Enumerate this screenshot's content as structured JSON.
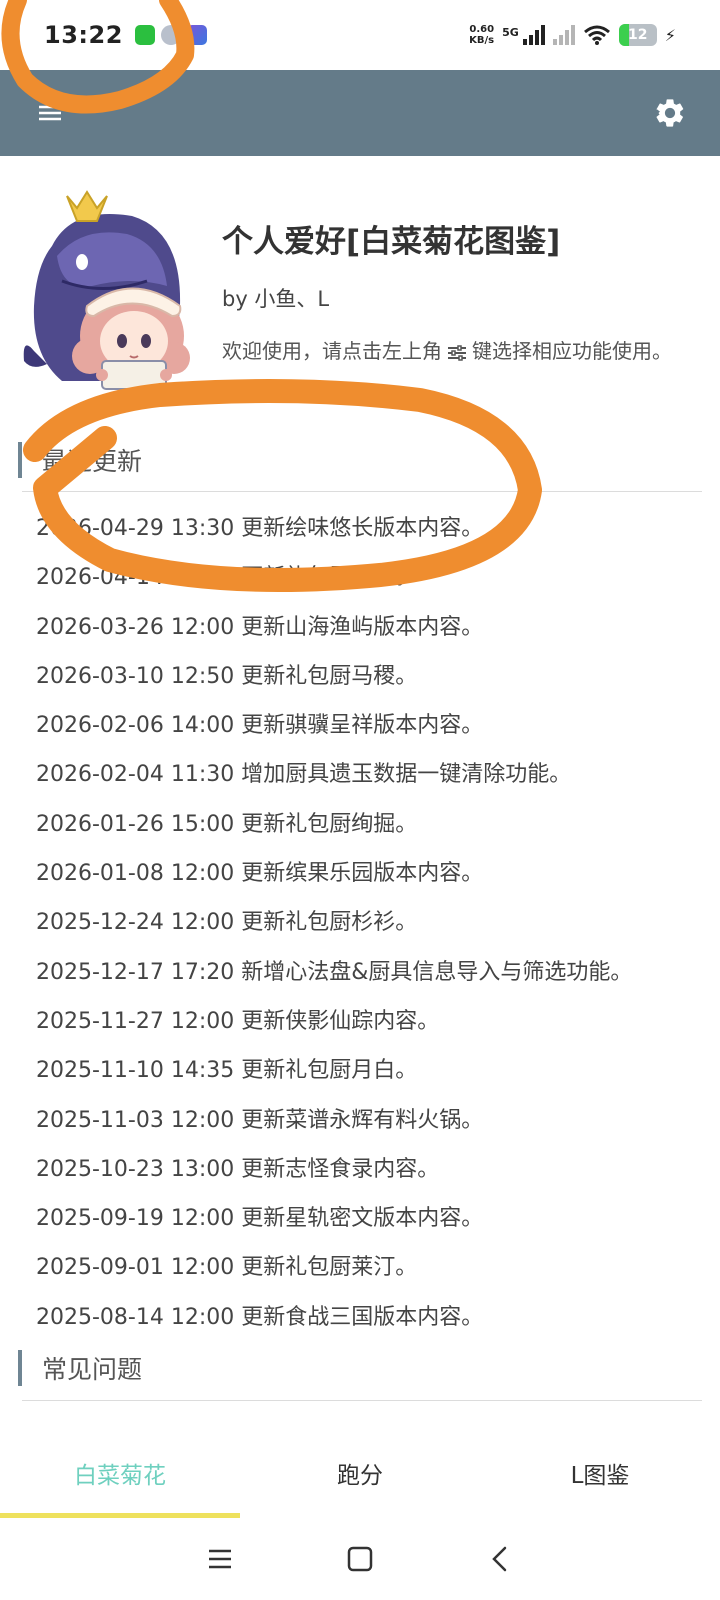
{
  "status_bar": {
    "time": "13:22",
    "net_speed_value": "0.60",
    "net_speed_unit": "KB/s",
    "network_type": "5G",
    "battery_level": "12",
    "icons": [
      "charging-app-icon",
      "sync-app-icon",
      "game-app-icon",
      "signal-icon",
      "signal-off-icon",
      "wifi-icon",
      "battery-icon",
      "charging-bolt-icon"
    ]
  },
  "app_bar": {
    "menu_icon": "menu-icon",
    "settings_icon": "gear-icon",
    "background": "#647b89"
  },
  "header": {
    "title": "个人爱好[白菜菊花图鉴]",
    "author": "by 小鱼、L",
    "desc_before": "欢迎使用，请点击左上角",
    "desc_after": "键选择相应功能使用。"
  },
  "recent_updates": {
    "title": "最近更新",
    "items": [
      "2026-04-29 13:30 更新绘味悠长版本内容。",
      "2026-04-14 10:30 更新礼包厨法彩。",
      "2026-03-26 12:00 更新山海渔屿版本内容。",
      "2026-03-10 12:50 更新礼包厨马稷。",
      "2026-02-06 14:00 更新骐骥呈祥版本内容。",
      "2026-02-04 11:30 增加厨具遗玉数据一键清除功能。",
      "2026-01-26 15:00 更新礼包厨绚掘。",
      "2026-01-08 12:00 更新缤果乐园版本内容。",
      "2025-12-24 12:00 更新礼包厨杉衫。",
      "2025-12-17 17:20 新增心法盘&厨具信息导入与筛选功能。",
      "2025-11-27 12:00 更新侠影仙踪内容。",
      "2025-11-10 14:35 更新礼包厨月白。",
      "2025-11-03 12:00 更新菜谱永辉有料火锅。",
      "2025-10-23 13:00 更新志怪食录内容。",
      "2025-09-19 12:00 更新星轨密文版本内容。",
      "2025-09-01 12:00 更新礼包厨莱汀。",
      "2025-08-14 12:00 更新食战三国版本内容。"
    ]
  },
  "faq": {
    "title": "常见问题"
  },
  "tabs": [
    {
      "label": "白菜菊花",
      "active": true
    },
    {
      "label": "跑分",
      "active": false
    },
    {
      "label": "L图鉴",
      "active": false
    }
  ],
  "colors": {
    "accent_tab": "#6fd0bf",
    "tab_indicator": "#eee15d",
    "annotation": "#ef8d2f"
  }
}
